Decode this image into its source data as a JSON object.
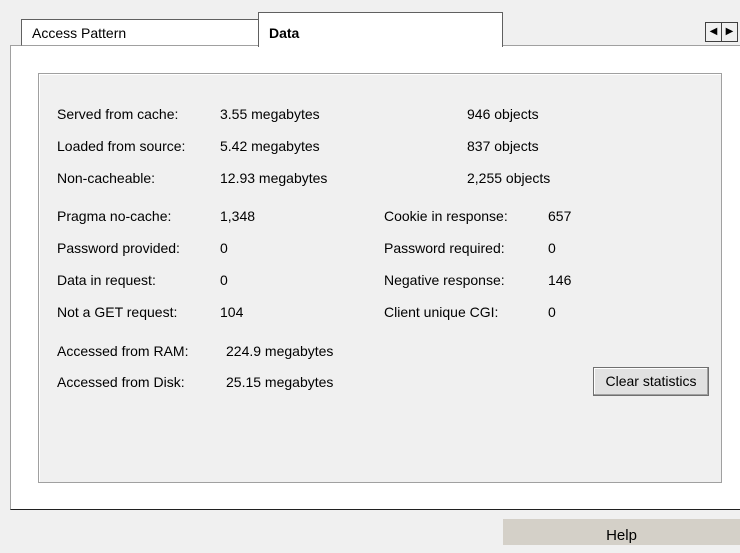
{
  "tabs": [
    {
      "label": "Access Pattern"
    },
    {
      "label": "Data"
    }
  ],
  "scroll": {
    "left": "◀",
    "right": "▶"
  },
  "cache": [
    {
      "label": "Served from cache:",
      "size": "3.55 megabytes",
      "objects": "946 objects"
    },
    {
      "label": "Loaded from source:",
      "size": "5.42 megabytes",
      "objects": "837 objects"
    },
    {
      "label": "Non-cacheable:",
      "size": "12.93 megabytes",
      "objects": "2,255 objects"
    }
  ],
  "left_stats": [
    {
      "label": "Pragma no-cache:",
      "value": "1,348"
    },
    {
      "label": "Password provided:",
      "value": "0"
    },
    {
      "label": "Data in request:",
      "value": "0"
    },
    {
      "label": "Not a GET request:",
      "value": "104"
    }
  ],
  "right_stats": [
    {
      "label": "Cookie in response:",
      "value": "657"
    },
    {
      "label": "Password required:",
      "value": "0"
    },
    {
      "label": "Negative response:",
      "value": "146"
    },
    {
      "label": "Client unique CGI:",
      "value": "0"
    }
  ],
  "access": [
    {
      "label": "Accessed from RAM:",
      "value": "224.9 megabytes"
    },
    {
      "label": "Accessed from Disk:",
      "value": "25.15 megabytes"
    }
  ],
  "buttons": {
    "clear": "Clear statistics",
    "help": "Help"
  }
}
